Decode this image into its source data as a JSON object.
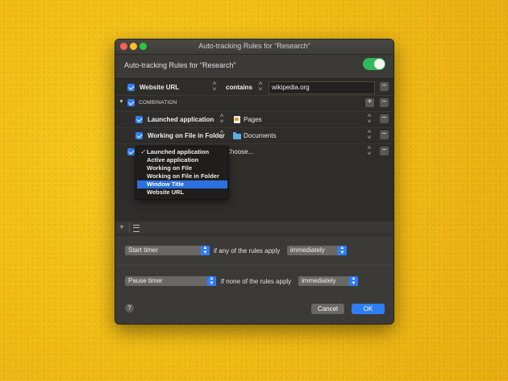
{
  "window": {
    "title": "Auto-tracking Rules for “Research”"
  },
  "header": {
    "label": "Auto-tracking Rules for “Research”",
    "enabled": true
  },
  "rules": {
    "row1": {
      "field": "Website URL",
      "operator": "contains",
      "value": "wikipedia.org"
    },
    "combination": {
      "label": "COMBINATION"
    },
    "row2": {
      "field": "Launched application",
      "value": "Pages"
    },
    "row3": {
      "field": "Working on File in Folder",
      "value": "Documents"
    },
    "row4": {
      "value": "Choose..."
    }
  },
  "dropdown": {
    "checked_index": 0,
    "selected_index": 4,
    "items": [
      "Launched application",
      "Active application",
      "Working on File",
      "Working on File in Folder",
      "Window Title",
      "Website URL"
    ],
    "checkmark": "✓"
  },
  "bottombar": {
    "add": "+",
    "remove": "−"
  },
  "actions": {
    "start": {
      "action": "Start timer",
      "condition": "if any of the rules apply",
      "timing": "immediately"
    },
    "pause": {
      "action": "Pause timer",
      "condition": "if none of the rules apply",
      "timing": "immediately"
    }
  },
  "footer": {
    "help": "?",
    "cancel": "Cancel",
    "ok": "OK"
  },
  "colors": {
    "accent": "#2e7ef6",
    "toggle_on": "#2fb95a",
    "background": "#f0bb12"
  },
  "icons": {
    "minus": "−",
    "plus": "+",
    "disclosure": "▼",
    "updown": "˄˅"
  }
}
